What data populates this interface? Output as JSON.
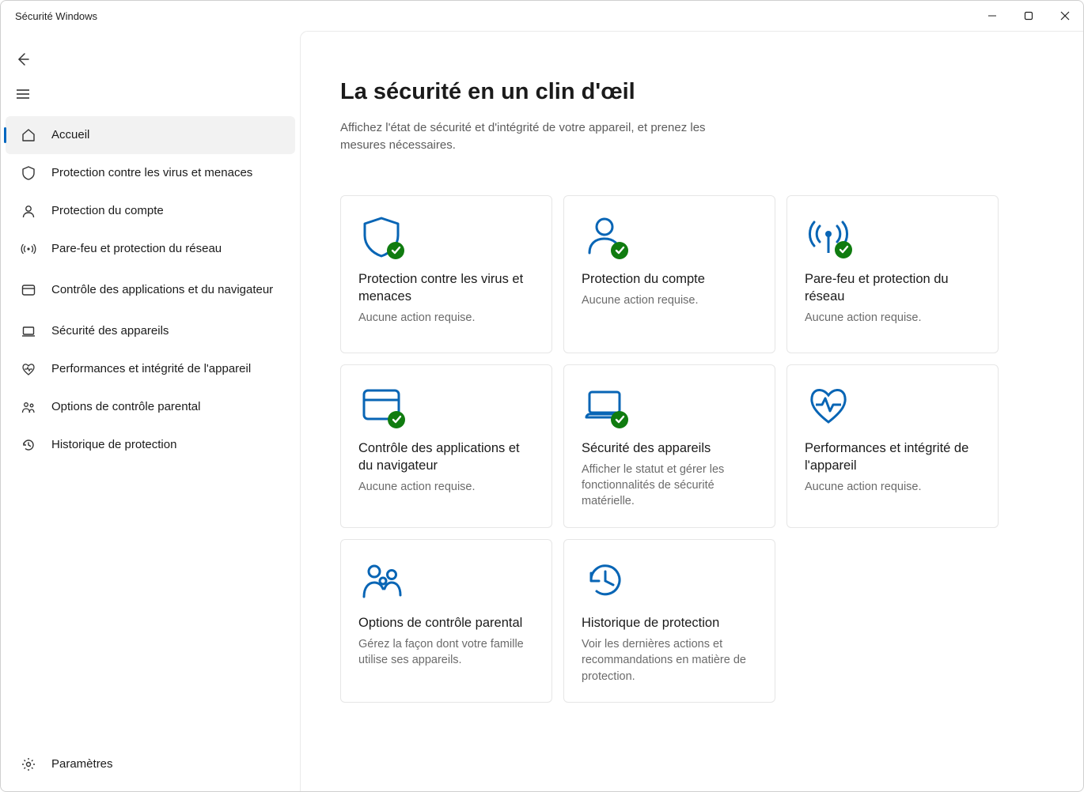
{
  "window": {
    "title": "Sécurité Windows"
  },
  "sidebar": {
    "items": [
      {
        "label": "Accueil"
      },
      {
        "label": "Protection contre les virus et menaces"
      },
      {
        "label": "Protection du compte"
      },
      {
        "label": "Pare-feu et protection du réseau"
      },
      {
        "label": "Contrôle des applications et du navigateur"
      },
      {
        "label": "Sécurité des appareils"
      },
      {
        "label": "Performances et intégrité de l'appareil"
      },
      {
        "label": "Options de contrôle parental"
      },
      {
        "label": "Historique de protection"
      }
    ],
    "settings_label": "Paramètres"
  },
  "page": {
    "title": "La sécurité en un clin d'œil",
    "subtitle": "Affichez l'état de sécurité et d'intégrité de votre appareil, et prenez les mesures nécessaires."
  },
  "cards": [
    {
      "title": "Protection contre les virus et menaces",
      "desc": "Aucune action requise."
    },
    {
      "title": "Protection du compte",
      "desc": "Aucune action requise."
    },
    {
      "title": "Pare-feu et protection du réseau",
      "desc": "Aucune action requise."
    },
    {
      "title": "Contrôle des applications et du navigateur",
      "desc": "Aucune action requise."
    },
    {
      "title": "Sécurité des appareils",
      "desc": "Afficher le statut et gérer les fonctionnalités de sécurité matérielle."
    },
    {
      "title": "Performances et intégrité de l'appareil",
      "desc": "Aucune action requise."
    },
    {
      "title": "Options de contrôle parental",
      "desc": "Gérez la façon dont votre famille utilise ses appareils."
    },
    {
      "title": "Historique de protection",
      "desc": "Voir les dernières actions et recommandations en matière de protection."
    }
  ]
}
